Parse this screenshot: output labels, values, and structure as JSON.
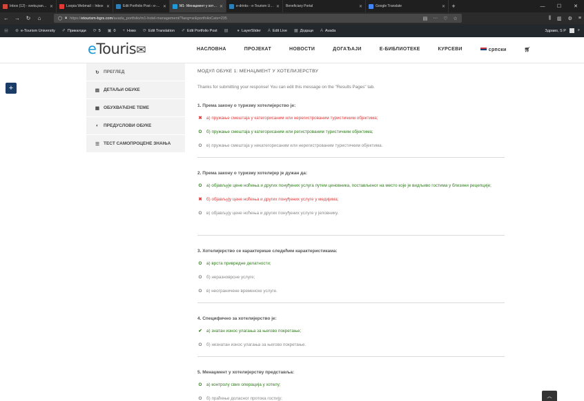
{
  "browser": {
    "tabs": [
      {
        "title": "Inbox (12) - sveta.pantic@p",
        "color": "#d44638"
      },
      {
        "title": "Loopia Webmail :: Inbox",
        "color": "#e53935"
      },
      {
        "title": "Edit Portfolio Post ‹ e-Touris",
        "color": "#2d7fb8"
      },
      {
        "title": "M1- Менаџмент у хотелије",
        "color": "#1f9ad6",
        "active": true
      },
      {
        "title": "e-drinks - e-Tourism Univers",
        "color": "#2d7fb8"
      },
      {
        "title": "Beneficiary Portal",
        "color": "#3b3b3b"
      },
      {
        "title": "Google Translate",
        "color": "#4285f4"
      }
    ],
    "url_prefix": "https://",
    "url_host": "etourism-bgrs.com",
    "url_path": "/avada_portfolio/m1-hotel-management/?lang=sr&portfolioCats=235",
    "win_min": "—",
    "win_max": "☐",
    "win_close": "✕"
  },
  "adminbar": {
    "items": [
      {
        "icon": "⊕",
        "label": "e-Tourism University"
      },
      {
        "icon": "✐",
        "label": "Прикагоди"
      },
      {
        "icon": "⟳",
        "label": "5"
      },
      {
        "icon": "▣",
        "label": "0"
      },
      {
        "icon": "+",
        "label": "Ново"
      },
      {
        "icon": "⟳",
        "label": "Edit Translation"
      },
      {
        "icon": "✐",
        "label": "Edit Portfolio Post"
      },
      {
        "icon": "▤",
        "label": ""
      },
      {
        "icon": "●",
        "label": "LayerSlider"
      },
      {
        "icon": "A",
        "label": "Edit Live"
      },
      {
        "icon": "▦",
        "label": "Додаци"
      },
      {
        "icon": "A",
        "label": "Avada"
      }
    ],
    "greeting": "Здраво, S P"
  },
  "site": {
    "logo_e": "e",
    "logo_rest": "Touris",
    "nav": [
      "НАСЛОВНА",
      "ПРОЈЕКАТ",
      "НОВОСТИ",
      "ДОГАЂАЈИ",
      "Е-БИБЛИОТЕКЕ",
      "КУРСЕВИ"
    ],
    "lang": "српски"
  },
  "sidebar": {
    "items": [
      {
        "icon": "↻",
        "label": "ПРЕГЛЕД"
      },
      {
        "icon": "▤",
        "label": "ДЕТАЉИ ОБУКЕ"
      },
      {
        "icon": "▦",
        "label": "ОБУХВАЋЕНЕ ТЕМЕ"
      },
      {
        "icon": "◐",
        "label": "ПРЕДУСЛОВИ ОБУКЕ"
      },
      {
        "icon": "☰",
        "label": "ТЕСТ САМОПРОЦЕНЕ ЗНАЊА"
      }
    ]
  },
  "content": {
    "module_title": "МОДУЛ ОБУКЕ 1: МЕНАЏМЕНТ У ХОТЕЛИЈЕРСТВУ",
    "thanks": "Thanks for submitting your response! You can edit this message on the \"Results Pages\" tab.",
    "questions": [
      {
        "title": "1. Према закону о туризму хотелијерство је:",
        "options": [
          {
            "mark": "✖",
            "text": "а) пружање смештаја у категорисаним или нерегистрованим туристичким објектима;",
            "state": "wrong"
          },
          {
            "mark": "O",
            "text": "б) пружање смештаја у категорисаним или регистрованим туристичким објектима;",
            "state": "correct"
          },
          {
            "mark": "O",
            "text": "в) пружање смештаја у некатегорисаним или нерегистрованим туристичким објектима.",
            "state": "neutral"
          }
        ]
      },
      {
        "title": "2. Према закону о туризму хотелијер је дужан да:",
        "options": [
          {
            "mark": "O",
            "text": "а) објављује цене ноћења и других понуђених услуга путем ценовника, постављеног на место које је видљиво гостима у близини рецепције;",
            "state": "correct"
          },
          {
            "mark": "✖",
            "text": "б) објављују цене ноћења и других понуђених услуге у медијима;",
            "state": "wrong"
          },
          {
            "mark": "O",
            "text": "в) објављују цене ноћења и других понуђених услуге у јеловнику.",
            "state": "neutral"
          }
        ]
      },
      {
        "title": "3. Хотелијерство се карактерише следећим карактеристикама:",
        "options": [
          {
            "mark": "O",
            "text": "а) врста привредне делатности;",
            "state": "correct"
          },
          {
            "mark": "O",
            "text": "б) неразноврсне услуге;",
            "state": "neutral"
          },
          {
            "mark": "O",
            "text": "в) неограничене временске услуге.",
            "state": "neutral"
          }
        ]
      },
      {
        "title": "4. Специфично за хотелијерство је:",
        "options": [
          {
            "mark": "✔",
            "text": "а) знатан износ улагања за његово покретање;",
            "state": "correct"
          },
          {
            "mark": "O",
            "text": "б) незнатан износ улагања за његово покретање.",
            "state": "neutral"
          }
        ]
      },
      {
        "title": "5. Менаџмент у хотелијерству представља:",
        "options": [
          {
            "mark": "O",
            "text": "а) контролу свих операција у хотелу;",
            "state": "correct"
          },
          {
            "mark": "O",
            "text": "б) праћење доласног протока гостију;",
            "state": "neutral"
          }
        ]
      }
    ]
  }
}
